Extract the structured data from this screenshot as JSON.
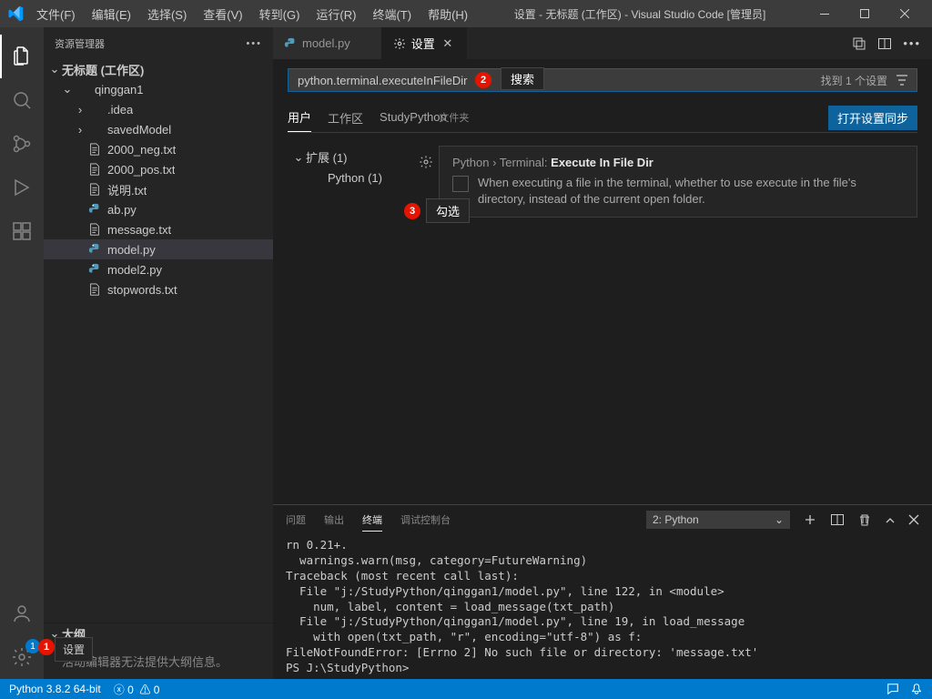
{
  "titlebar": {
    "menus": [
      "文件(F)",
      "编辑(E)",
      "选择(S)",
      "查看(V)",
      "转到(G)",
      "运行(R)",
      "终端(T)",
      "帮助(H)"
    ],
    "title": "设置 - 无标题 (工作区) - Visual Studio Code [管理员]"
  },
  "sidebar": {
    "title": "资源管理器",
    "workspace": "无标题 (工作区)",
    "tree": [
      {
        "indent": 1,
        "chev": "v",
        "icon": "",
        "label": "qinggan1",
        "bold": false
      },
      {
        "indent": 2,
        "chev": ">",
        "icon": "",
        "label": ".idea"
      },
      {
        "indent": 2,
        "chev": ">",
        "icon": "",
        "label": "savedModel"
      },
      {
        "indent": 2,
        "icon": "txt",
        "label": "2000_neg.txt"
      },
      {
        "indent": 2,
        "icon": "txt",
        "label": "2000_pos.txt"
      },
      {
        "indent": 2,
        "icon": "txt",
        "label": "说明.txt"
      },
      {
        "indent": 2,
        "icon": "py",
        "label": "ab.py"
      },
      {
        "indent": 2,
        "icon": "txt",
        "label": "message.txt"
      },
      {
        "indent": 2,
        "icon": "py",
        "label": "model.py",
        "selected": true
      },
      {
        "indent": 2,
        "icon": "py",
        "label": "model2.py"
      },
      {
        "indent": 2,
        "icon": "txt",
        "label": "stopwords.txt"
      }
    ],
    "outline_title": "大纲",
    "outline_msg": "活动编辑器无法提供大纲信息。"
  },
  "tabs": [
    {
      "icon": "py",
      "label": "model.py",
      "active": false
    },
    {
      "icon": "gear",
      "label": "设置",
      "active": true
    }
  ],
  "settings": {
    "search_value": "python.terminal.executeInFileDir",
    "search_hint": "搜索",
    "result": "找到 1 个设置",
    "scope_tabs": [
      "用户",
      "工作区",
      "StudyPython"
    ],
    "scope_folder_suffix": "文件夹",
    "sync_btn": "打开设置同步",
    "tree": [
      {
        "chev": "v",
        "label": "扩展 (1)"
      },
      {
        "indent": 1,
        "label": "Python (1)"
      }
    ],
    "item": {
      "crumb": "Python › Terminal:",
      "name": "Execute In File Dir",
      "desc": "When executing a file in the terminal, whether to use execute in the file's directory, instead of the current open folder."
    }
  },
  "annotations": {
    "a1": "1",
    "a2": "2",
    "a3": "3",
    "a3_label": "勾选"
  },
  "panel": {
    "tabs": [
      "问题",
      "输出",
      "终端",
      "调试控制台"
    ],
    "active": 2,
    "term_name": "2: Python",
    "output": "rn 0.21+.\n  warnings.warn(msg, category=FutureWarning)\nTraceback (most recent call last):\n  File \"j:/StudyPython/qinggan1/model.py\", line 122, in <module>\n    num, label, content = load_message(txt_path)\n  File \"j:/StudyPython/qinggan1/model.py\", line 19, in load_message\n    with open(txt_path, \"r\", encoding=\"utf-8\") as f:\nFileNotFoundError: [Errno 2] No such file or directory: 'message.txt'\nPS J:\\StudyPython>"
  },
  "statusbar": {
    "python": "Python 3.8.2 64-bit",
    "errors": "0",
    "warnings": "0"
  },
  "tooltip": "设置"
}
